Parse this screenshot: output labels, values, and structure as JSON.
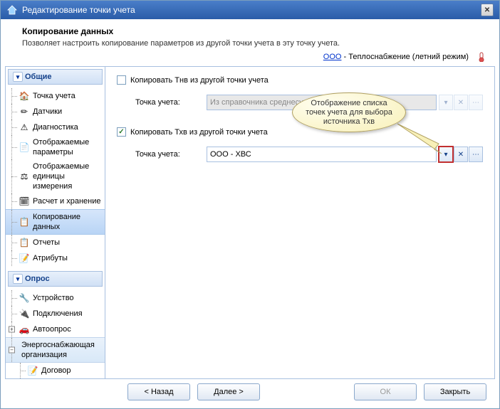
{
  "window": {
    "title": "Редактирование точки учета"
  },
  "header": {
    "title": "Копирование данных",
    "subtitle": "Позволяет настроить копирование параметров из другой точки учета в эту точку учета."
  },
  "context": {
    "link": "ООО",
    "suffix": " - Теплоснабжение  (летний режим)"
  },
  "sidebar": {
    "groups": [
      {
        "label": "Общие",
        "items": [
          {
            "label": "Точка учета",
            "icon": "🏠"
          },
          {
            "label": "Датчики",
            "icon": "✏"
          },
          {
            "label": "Диагностика",
            "icon": "⚠"
          },
          {
            "label": "Отображаемые параметры",
            "icon": "📄"
          },
          {
            "label": "Отображаемые единицы измерения",
            "icon": "⚖"
          },
          {
            "label": "Расчет и хранение",
            "icon": "🗓"
          },
          {
            "label": "Копирование данных",
            "icon": "📋",
            "selected": true
          },
          {
            "label": "Отчеты",
            "icon": "📋"
          },
          {
            "label": "Атрибуты",
            "icon": "📝"
          }
        ]
      },
      {
        "label": "Опрос",
        "items": [
          {
            "label": "Устройство",
            "icon": "🔧"
          },
          {
            "label": "Подключения",
            "icon": "🔌"
          },
          {
            "label": "Автоопрос",
            "icon": "🚗",
            "expandable": true
          },
          {
            "label": "Энергоснабжающая организация",
            "icon": "",
            "selected2": true
          },
          {
            "label": "Договор",
            "icon": "📝"
          }
        ]
      }
    ]
  },
  "form": {
    "copy_tnv_label": "Копировать Тнв из другой точки учета",
    "copy_thv_label": "Копировать Тхв из другой точки учета",
    "point_label": "Точка учета:",
    "tnv_placeholder": "Из справочника среднесу",
    "thv_value": "ООО - ХВС"
  },
  "callout": {
    "text": "Отображение списка точек учета для выбора источника Тхв"
  },
  "buttons": {
    "back": "< Назад",
    "next": "Далее >",
    "ok": "ОК",
    "close": "Закрыть"
  }
}
